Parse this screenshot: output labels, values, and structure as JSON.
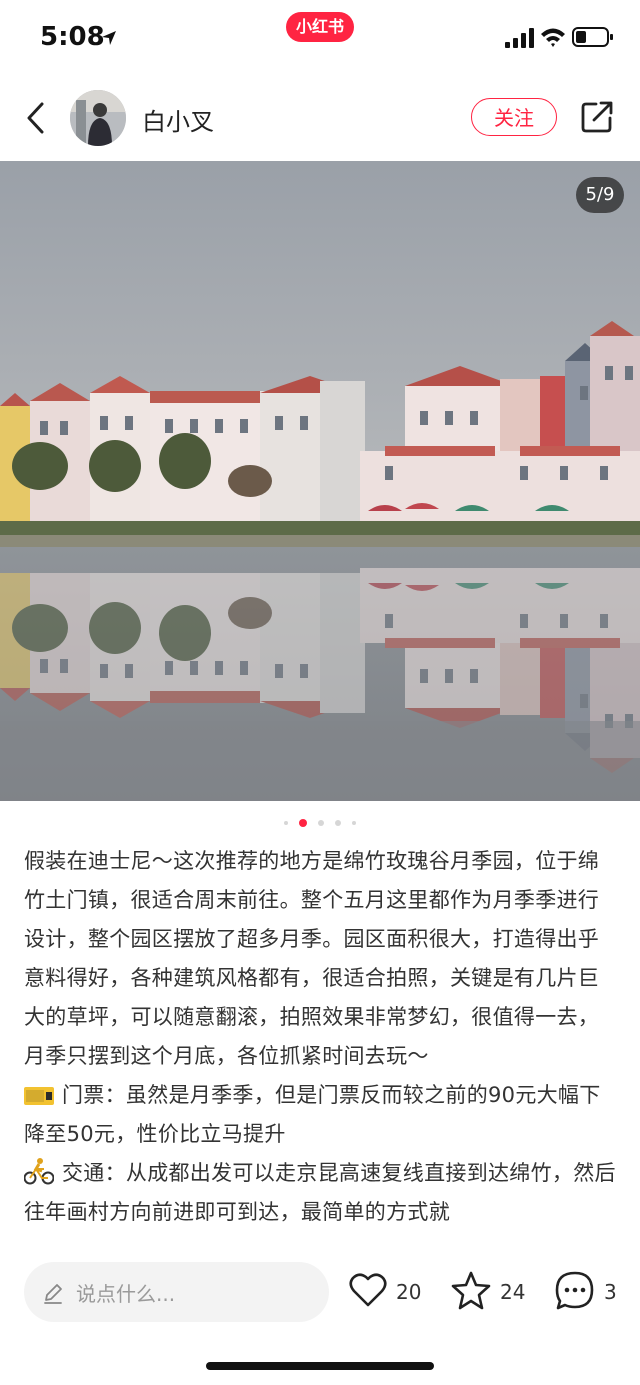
{
  "status": {
    "time": "5:08",
    "app_badge": "小红书"
  },
  "header": {
    "author_name": "白小叉",
    "follow_label": "关注"
  },
  "photo": {
    "counter": "5/9",
    "current_index": 2,
    "dot_count": 5
  },
  "content": {
    "paragraph": "假装在迪士尼～这次推荐的地方是绵竹玫瑰谷月季园，位于绵竹土门镇，很适合周末前往。整个五月这里都作为月季季进行设计，整个园区摆放了超多月季。园区面积很大，打造得出乎意料得好，各种建筑风格都有，很适合拍照，关键是有几片巨大的草坪，可以随意翻滚，拍照效果非常梦幻，很值得一去，月季只摆到这个月底，各位抓紧时间去玩～",
    "ticket_line": "门票：虽然是月季季，但是门票反而较之前的90元大幅下降至50元，性价比立马提升",
    "transport_line": "交通：从成都出发可以走京昆高速复线直接到达绵竹，然后往年画村方向前进即可到达，最简单的方式就"
  },
  "bottom": {
    "comment_placeholder": "说点什么...",
    "likes": "20",
    "collects": "24",
    "comments": "3"
  },
  "colors": {
    "accent": "#ff2442",
    "text": "#333333"
  }
}
